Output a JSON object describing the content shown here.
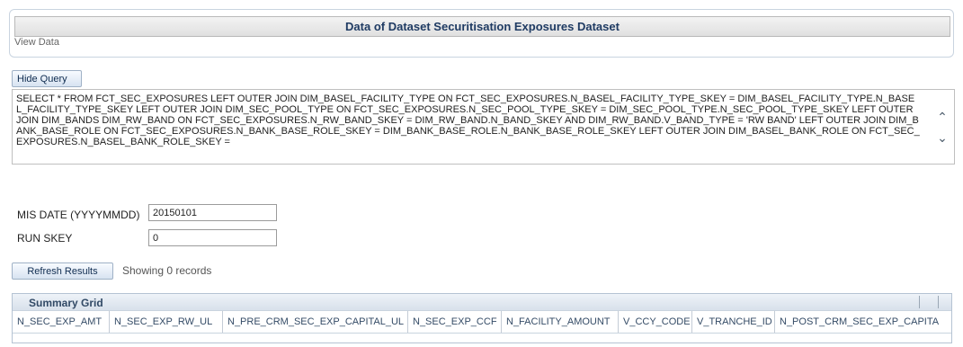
{
  "header": {
    "title": "Data of Dataset Securitisation Exposures Dataset",
    "subtitle": "View Data"
  },
  "query": {
    "button_label": "Hide Query",
    "text": "SELECT * FROM  FCT_SEC_EXPOSURES LEFT OUTER JOIN DIM_BASEL_FACILITY_TYPE ON FCT_SEC_EXPOSURES.N_BASEL_FACILITY_TYPE_SKEY = DIM_BASEL_FACILITY_TYPE.N_BASEL_FACILITY_TYPE_SKEY LEFT OUTER JOIN DIM_SEC_POOL_TYPE ON FCT_SEC_EXPOSURES.N_SEC_POOL_TYPE_SKEY = DIM_SEC_POOL_TYPE.N_SEC_POOL_TYPE_SKEY LEFT OUTER JOIN DIM_BANDS DIM_RW_BAND ON FCT_SEC_EXPOSURES.N_RW_BAND_SKEY = DIM_RW_BAND.N_BAND_SKEY AND DIM_RW_BAND.V_BAND_TYPE = 'RW BAND' LEFT OUTER JOIN DIM_BANK_BASE_ROLE ON FCT_SEC_EXPOSURES.N_BANK_BASE_ROLE_SKEY = DIM_BANK_BASE_ROLE.N_BANK_BASE_ROLE_SKEY LEFT OUTER JOIN DIM_BASEL_BANK_ROLE ON FCT_SEC_EXPOSURES.N_BASEL_BANK_ROLE_SKEY ="
  },
  "filters": {
    "mis_date_label": "MIS DATE (YYYYMMDD)",
    "mis_date_value": "20150101",
    "run_skey_label": "RUN SKEY",
    "run_skey_value": "0"
  },
  "results": {
    "refresh_label": "Refresh Results",
    "showing_text": "Showing 0 records"
  },
  "grid": {
    "title": "Summary Grid",
    "columns": [
      "N_SEC_EXP_AMT",
      "N_SEC_EXP_RW_UL",
      "N_PRE_CRM_SEC_EXP_CAPITAL_UL",
      "N_SEC_EXP_CCF",
      "N_FACILITY_AMOUNT",
      "V_CCY_CODE",
      "V_TRANCHE_ID",
      "N_POST_CRM_SEC_EXP_CAPITA"
    ]
  },
  "icons": {
    "scroll_up": "chevron-up-icon",
    "scroll_down": "chevron-down-icon"
  }
}
